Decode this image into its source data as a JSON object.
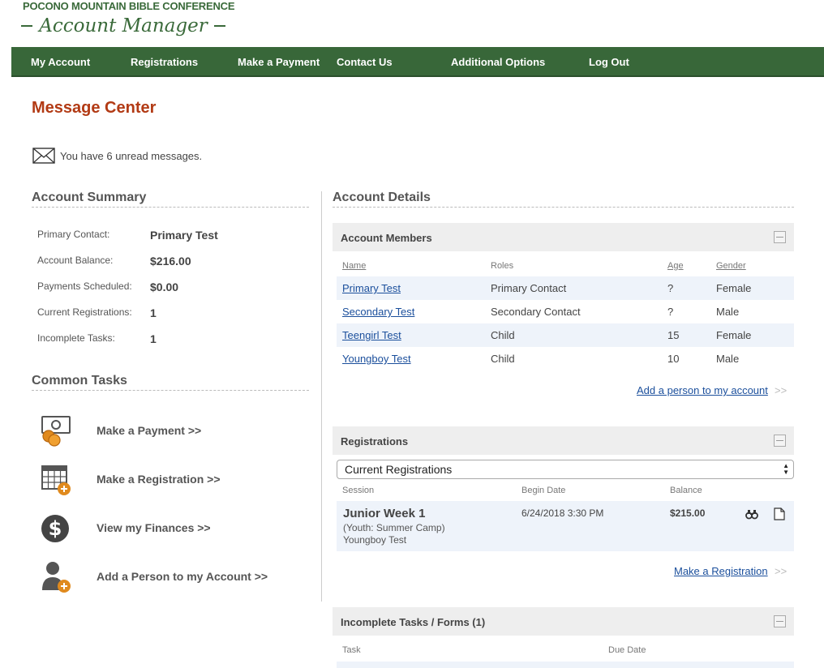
{
  "logo": {
    "org_name": "POCONO MOUNTAIN BIBLE CONFERENCE",
    "app_name": "Account Manager"
  },
  "nav": {
    "items": [
      "My Account",
      "Registrations",
      "Make a Payment",
      "Contact Us",
      "Additional Options",
      "Log Out"
    ]
  },
  "page": {
    "title": "Message Center",
    "message_text": "You have 6 unread messages."
  },
  "summary": {
    "title": "Account Summary",
    "rows": [
      {
        "label": "Primary Contact:",
        "value": "Primary Test"
      },
      {
        "label": "Account Balance:",
        "value": "$216.00"
      },
      {
        "label": "Payments Scheduled:",
        "value": "$0.00"
      },
      {
        "label": "Current Registrations:",
        "value": "1"
      },
      {
        "label": "Incomplete Tasks:",
        "value": "1"
      }
    ]
  },
  "common_tasks": {
    "title": "Common Tasks",
    "items": [
      {
        "label": "Make a Payment  >>",
        "icon": "payment-icon"
      },
      {
        "label": "Make a Registration  >>",
        "icon": "calendar-add-icon"
      },
      {
        "label": "View my Finances  >>",
        "icon": "dollar-icon"
      },
      {
        "label": "Add a Person to my Account  >>",
        "icon": "add-person-icon"
      }
    ]
  },
  "details": {
    "title": "Account Details",
    "members": {
      "title": "Account Members",
      "columns": {
        "name": "Name",
        "roles": "Roles",
        "age": "Age",
        "gender": "Gender"
      },
      "rows": [
        {
          "name": "Primary Test",
          "role": "Primary Contact",
          "age": "?",
          "gender": "Female"
        },
        {
          "name": "Secondary Test",
          "role": "Secondary Contact",
          "age": "?",
          "gender": "Male"
        },
        {
          "name": "Teengirl Test",
          "role": "Child",
          "age": "15",
          "gender": "Female"
        },
        {
          "name": "Youngboy Test",
          "role": "Child",
          "age": "10",
          "gender": "Male"
        }
      ],
      "add_link": "Add a person to my account",
      "chevrons": ">>"
    },
    "registrations": {
      "title": "Registrations",
      "selected": "Current Registrations",
      "columns": {
        "session": "Session",
        "begin": "Begin Date",
        "balance": "Balance"
      },
      "row": {
        "session": "Junior Week 1",
        "type": "(Youth: Summer Camp)",
        "person": "Youngboy Test",
        "begin": "6/24/2018 3:30 PM",
        "balance": "$215.00"
      },
      "add_link": "Make a Registration",
      "chevrons": ">>"
    },
    "tasks": {
      "title": "Incomplete Tasks / Forms (1)",
      "columns": {
        "task": "Task",
        "due": "Due Date"
      }
    }
  },
  "colors": {
    "nav_green": "#386739",
    "title_red": "#b23a14",
    "link_blue": "#1b4f9c",
    "icon_orange": "#e08a1e"
  }
}
